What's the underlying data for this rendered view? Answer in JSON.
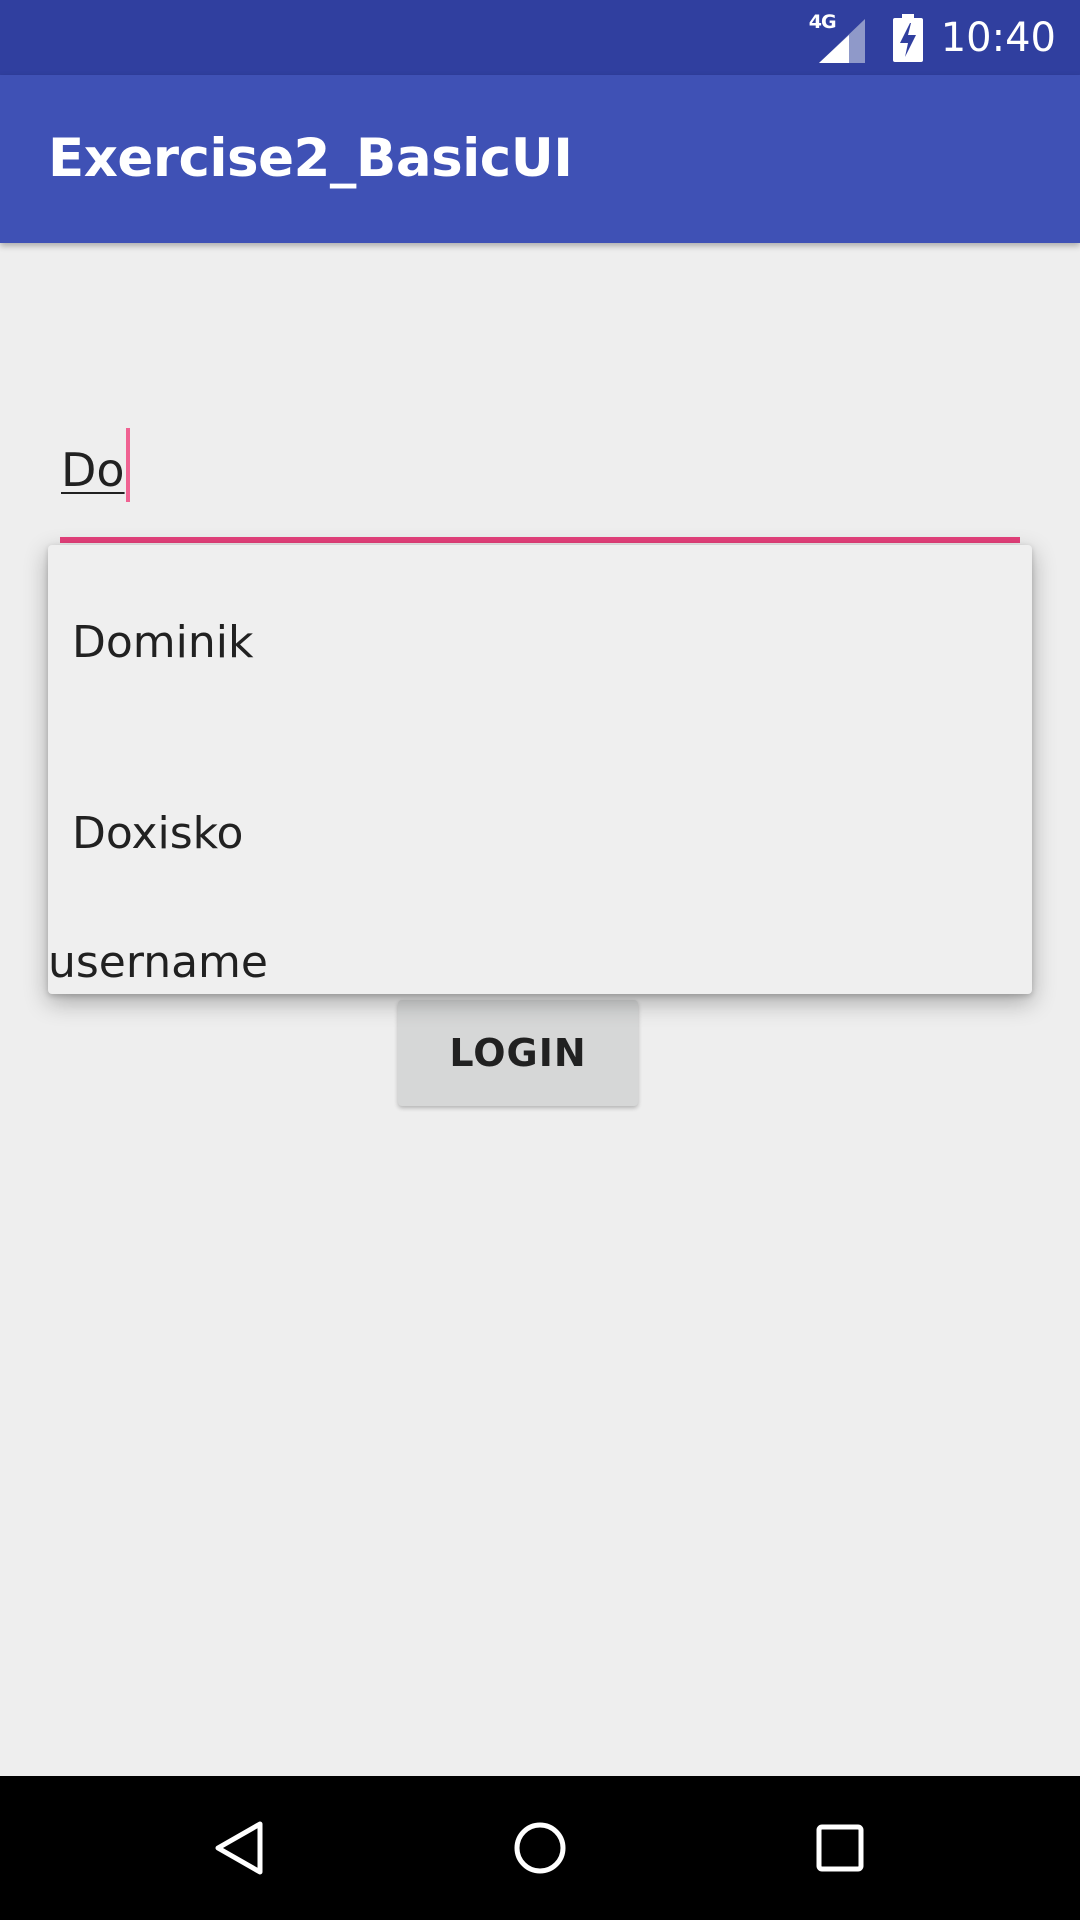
{
  "status_bar": {
    "network_label": "4G",
    "time": "10:40",
    "icons": [
      "signal-icon",
      "battery-charging-icon"
    ]
  },
  "app_bar": {
    "title": "Exercise2_BasicUI"
  },
  "input": {
    "value": "Do"
  },
  "dropdown": {
    "items": [
      {
        "label": "Dominik"
      },
      {
        "label": "Doxisko"
      }
    ],
    "footer_text": "username"
  },
  "login_button": {
    "label": "LOGIN"
  },
  "nav_bar": {
    "icons": [
      "back-icon",
      "home-icon",
      "recents-icon"
    ]
  },
  "colors": {
    "status_bar": "#303f9f",
    "app_bar": "#3f51b5",
    "accent": "#e5407b",
    "background": "#eeeeee",
    "button": "#d6d7d7"
  }
}
